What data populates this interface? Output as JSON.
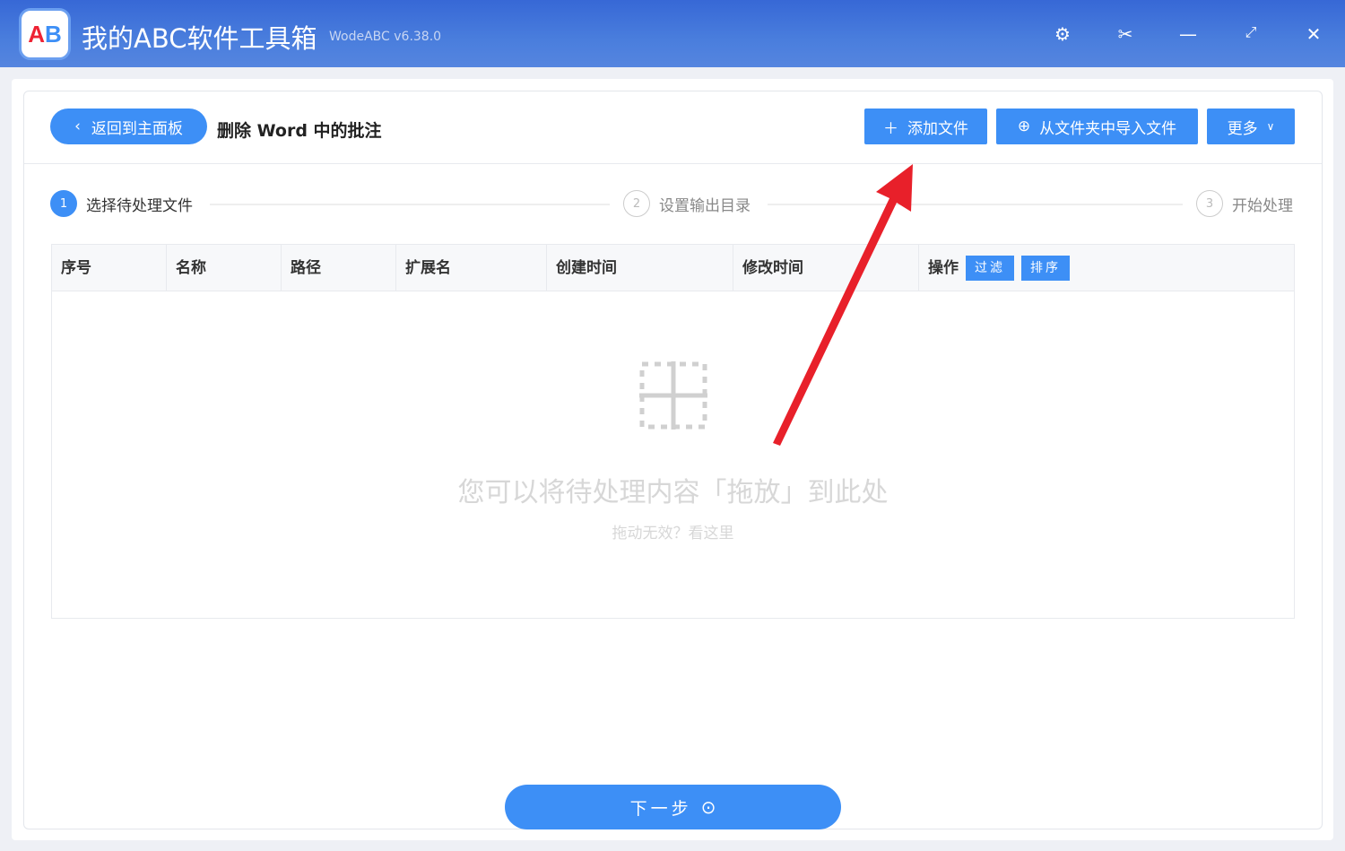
{
  "app": {
    "title": "我的ABC软件工具箱",
    "version": "WodeABC v6.38.0",
    "logo_text": "AB"
  },
  "window_controls": [
    "settings-icon",
    "scissors-icon",
    "minimize-icon",
    "maximize-icon",
    "close-icon"
  ],
  "header": {
    "back_label": "返回到主面板",
    "page_title": "删除 Word 中的批注",
    "add_file": "添加文件",
    "import_folder": "从文件夹中导入文件",
    "more": "更多"
  },
  "steps": [
    {
      "num": "1",
      "label": "选择待处理文件"
    },
    {
      "num": "2",
      "label": "设置输出目录"
    },
    {
      "num": "3",
      "label": "开始处理"
    }
  ],
  "table": {
    "columns": [
      "序号",
      "名称",
      "路径",
      "扩展名",
      "创建时间",
      "修改时间",
      "操作"
    ],
    "filter": "过滤",
    "sort": "排序"
  },
  "empty": {
    "main": "您可以将待处理内容「拖放」到此处",
    "hint": "拖动无效？看这里"
  },
  "footer": {
    "next": "下一步"
  },
  "colors": {
    "accent": "#3d8ff6",
    "arrow": "#e8202a"
  }
}
